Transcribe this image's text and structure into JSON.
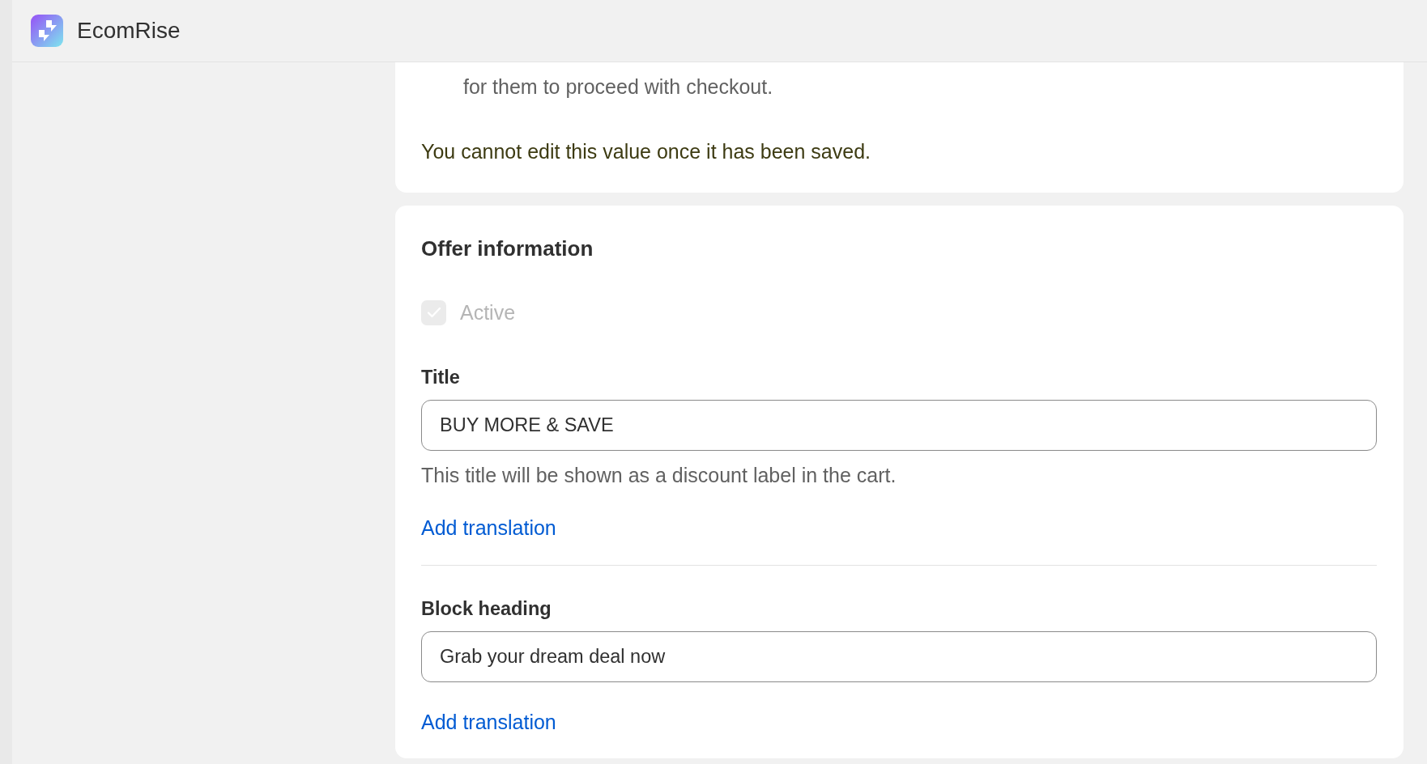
{
  "header": {
    "brand": "EcomRise"
  },
  "notice_card": {
    "list_continuation": "for them to proceed with checkout.",
    "warning": "You cannot edit this value once it has been saved."
  },
  "offer_card": {
    "heading": "Offer information",
    "active_checkbox": {
      "label": "Active",
      "checked": true,
      "disabled": true
    },
    "fields": [
      {
        "label": "Title",
        "value": "BUY MORE & SAVE",
        "help": "This title will be shown as a discount label in the cart.",
        "link": "Add translation"
      },
      {
        "label": "Block heading",
        "value": "Grab your dream deal now",
        "link": "Add translation"
      }
    ]
  }
}
